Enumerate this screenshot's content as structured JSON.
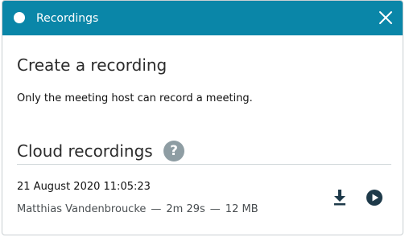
{
  "dialog": {
    "title": "Recordings",
    "close_icon": "close-icon",
    "status_icon": "white-dot-icon"
  },
  "create": {
    "heading": "Create a recording",
    "description": "Only the meeting host can record a meeting."
  },
  "cloud": {
    "heading": "Cloud recordings",
    "help_glyph": "?",
    "help_icon": "help-icon"
  },
  "recordings": [
    {
      "date": "21 August 2020 11:05:23",
      "owner": "Matthias Vandenbroucke",
      "duration": "2m 29s",
      "size": "12 MB",
      "separator": "—",
      "actions": [
        "download-icon",
        "play-icon"
      ]
    }
  ],
  "colors": {
    "titlebar": "#0a86a8",
    "icon_dark": "#1e3a4a",
    "help_bg": "#8e9da3"
  }
}
